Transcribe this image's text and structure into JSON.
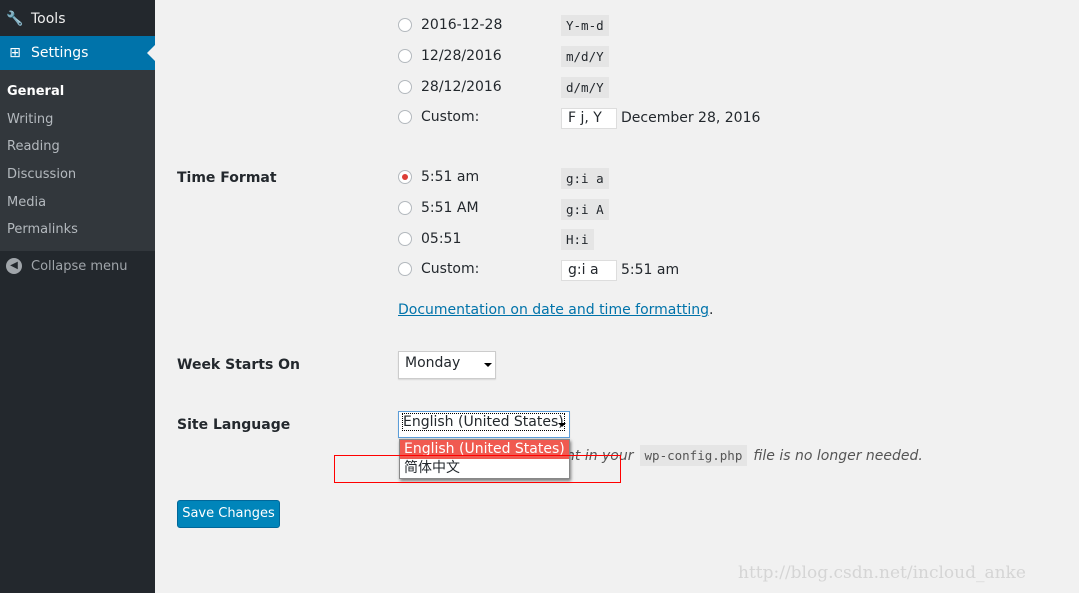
{
  "sidebar": {
    "tools": "Tools",
    "settings": "Settings",
    "sub": [
      "General",
      "Writing",
      "Reading",
      "Discussion",
      "Media",
      "Permalinks"
    ],
    "collapse": "Collapse menu"
  },
  "date_format": {
    "options": [
      {
        "label": "2016-12-28",
        "code": "Y-m-d"
      },
      {
        "label": "12/28/2016",
        "code": "m/d/Y"
      },
      {
        "label": "28/12/2016",
        "code": "d/m/Y"
      }
    ],
    "custom_label": "Custom:",
    "custom_value": "F j, Y",
    "custom_preview": "December 28, 2016"
  },
  "time_format": {
    "label": "Time Format",
    "options": [
      {
        "label": "5:51 am",
        "code": "g:i a",
        "checked": true
      },
      {
        "label": "5:51 AM",
        "code": "g:i A"
      },
      {
        "label": "05:51",
        "code": "H:i"
      }
    ],
    "custom_label": "Custom:",
    "custom_value": "g:i a",
    "custom_preview": "5:51 am",
    "doc_link": "Documentation on date and time formatting",
    "doc_suffix": "."
  },
  "week": {
    "label": "Week Starts On",
    "value": "Monday"
  },
  "language": {
    "label": "Site Language",
    "value": "English (United States)",
    "options": [
      "English (United States)",
      "简体中文"
    ],
    "note_visible": "nt in your",
    "note_code": "wp-config.php",
    "note_end": "file is no longer needed."
  },
  "save": "Save Changes",
  "watermark": "http://blog.csdn.net/incloud_anke"
}
